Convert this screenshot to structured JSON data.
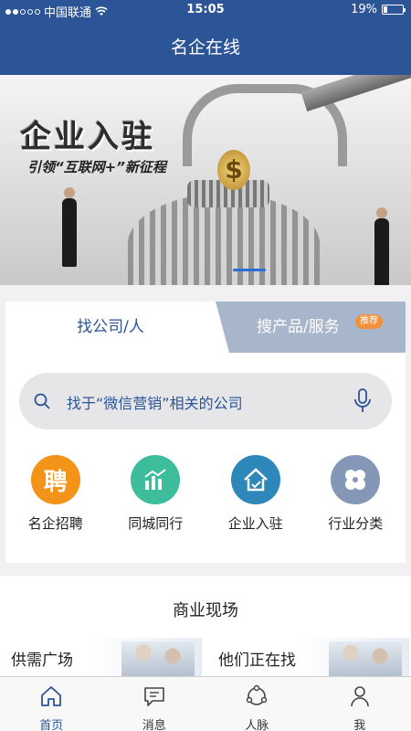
{
  "status_bar": {
    "carrier": "中国联通",
    "time": "15:05",
    "battery_text": "19%",
    "battery_level": 0.19
  },
  "navbar": {
    "title": "名企在线"
  },
  "banner": {
    "title": "企业入驻",
    "subtitle": "引领“互联网+”新征程",
    "coin_symbol": "$"
  },
  "search_tabs": {
    "active_label": "找公司/人",
    "inactive_label": "搜产品/服务",
    "badge": "推荐"
  },
  "search": {
    "placeholder": "找于“微信营销”相关的公司"
  },
  "categories": [
    {
      "label": "名企招聘",
      "icon": "recruit-icon",
      "color": "#f39318",
      "glyph": "聘"
    },
    {
      "label": "同城同行",
      "icon": "chart-icon",
      "color": "#3dbd9c",
      "glyph": ""
    },
    {
      "label": "企业入驻",
      "icon": "house-icon",
      "color": "#2d87b9",
      "glyph": ""
    },
    {
      "label": "行业分类",
      "icon": "clover-icon",
      "color": "#8497b7",
      "glyph": ""
    }
  ],
  "business": {
    "title": "商业现场",
    "cards": [
      "供需广场",
      "他们正在找"
    ]
  },
  "tab_bar": {
    "items": [
      {
        "label": "首页",
        "icon": "home-icon"
      },
      {
        "label": "消息",
        "icon": "message-icon"
      },
      {
        "label": "人脉",
        "icon": "network-icon"
      },
      {
        "label": "我",
        "icon": "person-icon"
      }
    ],
    "active_color": "#2b5597"
  },
  "colors": {
    "primary": "#2b5597",
    "badge": "#f3913a"
  }
}
